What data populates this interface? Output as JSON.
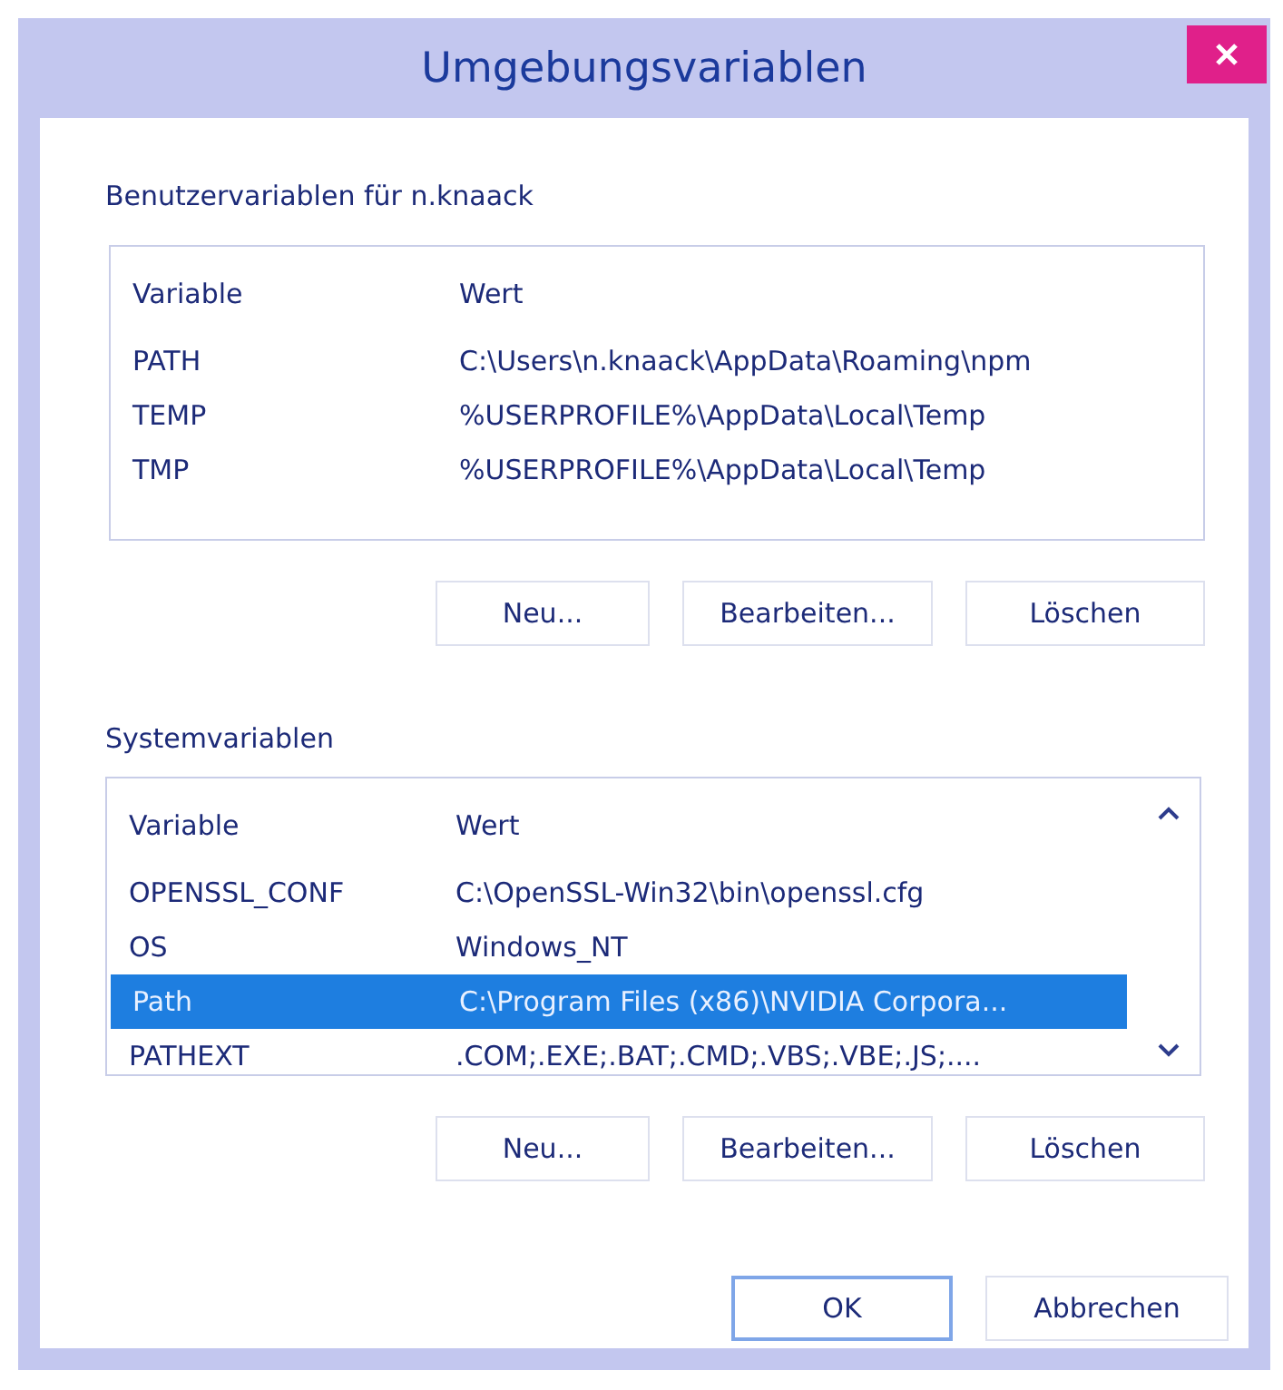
{
  "window": {
    "title": "Umgebungsvariablen"
  },
  "user_variables": {
    "label": "Benutzervariablen für n.knaack",
    "columns": [
      "Variable",
      "Wert"
    ],
    "rows": [
      {
        "name": "PATH",
        "value": "C:\\Users\\n.knaack\\AppData\\Roaming\\npm",
        "selected": false
      },
      {
        "name": "TEMP",
        "value": "%USERPROFILE%\\AppData\\Local\\Temp",
        "selected": false
      },
      {
        "name": "TMP",
        "value": "%USERPROFILE%\\AppData\\Local\\Temp",
        "selected": false
      }
    ],
    "buttons": [
      "Neu...",
      "Bearbeiten...",
      "Löschen"
    ]
  },
  "system_variables": {
    "label": "Systemvariablen",
    "columns": [
      "Variable",
      "Wert"
    ],
    "rows": [
      {
        "name": "OPENSSL_CONF",
        "value": "C:\\OpenSSL-Win32\\bin\\openssl.cfg",
        "selected": false
      },
      {
        "name": "OS",
        "value": "Windows_NT",
        "selected": false
      },
      {
        "name": "Path",
        "value": "C:\\Program Files (x86)\\NVIDIA Corpora...",
        "selected": true
      },
      {
        "name": "PATHEXT",
        "value": ".COM;.EXE;.BAT;.CMD;.VBS;.VBE;.JS;....",
        "selected": false
      }
    ],
    "buttons": [
      "Neu...",
      "Bearbeiten...",
      "Löschen"
    ]
  },
  "buttons": [
    "OK",
    "Abbrechen"
  ]
}
